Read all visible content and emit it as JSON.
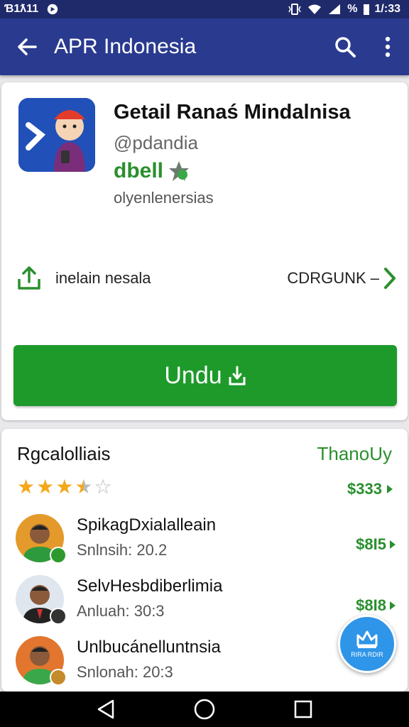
{
  "status_bar": {
    "left_text": "Ɓ1ƛ11",
    "right_text": "1/:33",
    "battery_text": "%"
  },
  "app_bar": {
    "title": "APR Indonesia"
  },
  "app": {
    "name": "Getail Ranaś Mindalnisa",
    "developer": "@pdandia",
    "rating_text": "dbell",
    "category": "olyenlenersias",
    "info_label": "inelain nesala",
    "info_link": "CDRGUNK –",
    "install_label": "Undu"
  },
  "reviews_section": {
    "title": "Rgcalolliais",
    "link": "ThanoUy",
    "stars": [
      1,
      1,
      1,
      0.5,
      0
    ],
    "top_price": "$333",
    "items": [
      {
        "name": "SpikagDxialalleain",
        "sub": "Snlnsih: 20.2",
        "price": "$8I5",
        "avatar_bg": "#e49a2a",
        "badge_color": "#2e9a2e"
      },
      {
        "name": "SelvHesbdiberlimia",
        "sub": "Anluah: 30:3",
        "price": "$8I8",
        "avatar_bg": "#dfe6ee",
        "badge_color": "#333333"
      },
      {
        "name": "Unlbucánelluntnsia",
        "sub": "Snlonah: 20:3",
        "price": "",
        "avatar_bg": "#e2762e",
        "badge_color": "#c58a2a"
      }
    ]
  },
  "fab": {
    "label": "RIRA RDIR"
  },
  "colors": {
    "app_bar": "#2a3a8f",
    "status_bar": "#1f2a6b",
    "accent_green": "#1e9a2b",
    "fab_blue": "#2f95e8"
  }
}
